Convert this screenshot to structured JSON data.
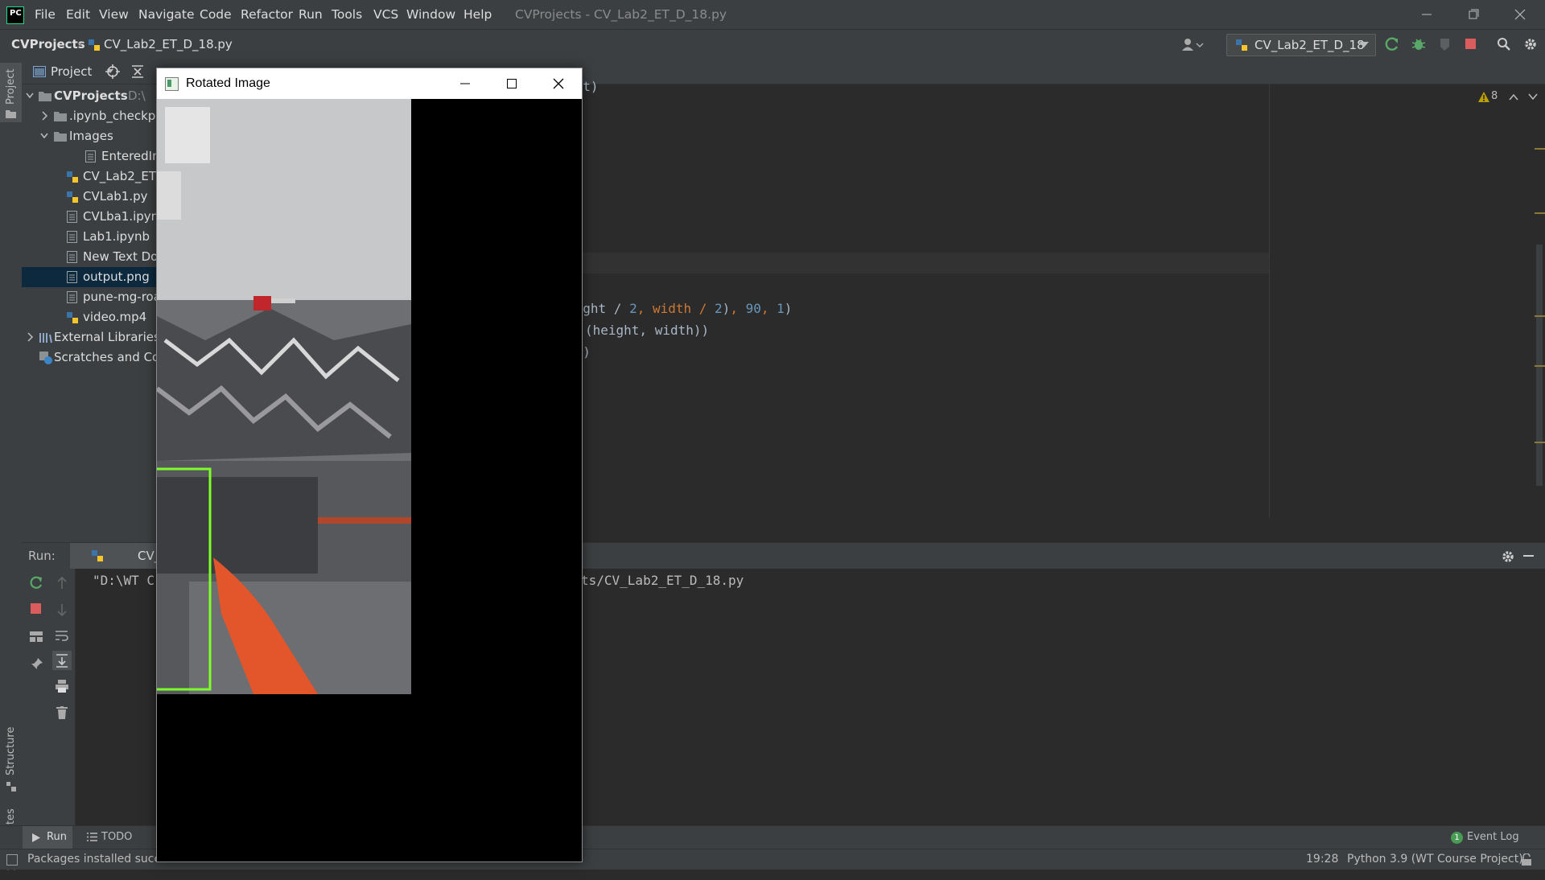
{
  "app": {
    "title": "CVProjects - CV_Lab2_ET_D_18.py",
    "menu": [
      "File",
      "Edit",
      "View",
      "Navigate",
      "Code",
      "Refactor",
      "Run",
      "Tools",
      "VCS",
      "Window",
      "Help"
    ]
  },
  "navbar": {
    "project": "CVProjects",
    "file": "CV_Lab2_ET_D_18.py",
    "run_config": "CV_Lab2_ET_D_18"
  },
  "left_strip": {
    "project_label": "Project",
    "structure_label": "Structure",
    "favorites_label": "Favorites"
  },
  "project_panel": {
    "view_label": "Project",
    "tree": [
      {
        "name": "CVProjects",
        "extra": "D:\\",
        "type": "folder",
        "expanded": true
      },
      {
        "name": ".ipynb_checkpoints",
        "type": "folder",
        "expanded": false
      },
      {
        "name": "Images",
        "type": "folder",
        "expanded": true
      },
      {
        "name": "EnteredImage",
        "type": "file"
      },
      {
        "name": "CV_Lab2_ET_D_18.py",
        "type": "python"
      },
      {
        "name": "CVLab1.py",
        "type": "python"
      },
      {
        "name": "CVLba1.ipynb",
        "type": "file"
      },
      {
        "name": "Lab1.ipynb",
        "type": "file"
      },
      {
        "name": "New Text Document",
        "type": "file"
      },
      {
        "name": "output.png",
        "type": "file",
        "selected": true
      },
      {
        "name": "pune-mg-road",
        "type": "file"
      },
      {
        "name": "video.mp4",
        "type": "python"
      },
      {
        "name": "External Libraries",
        "type": "library"
      },
      {
        "name": "Scratches and Consoles",
        "type": "scratch"
      }
    ]
  },
  "editor": {
    "warnings": "8",
    "code": {
      "line_top": "dst)",
      "l1_a": "eight / ",
      "l1_b": "2",
      "l1_c": ", width / ",
      "l1_d": "2",
      "l1_e": ")",
      "l1_f": ", ",
      "l1_g": "90",
      "l1_h": ", ",
      "l1_i": "1",
      "l1_j": ")",
      "l2": "(height, width))",
      "l3": "st)"
    }
  },
  "run_panel": {
    "label": "Run:",
    "tab": "CV_Lab2_ET_D_18",
    "console_start": "\"D:\\WT C",
    "console_end": "ts/CV_Lab2_ET_D_18.py"
  },
  "bottom_tools": {
    "run": "Run",
    "todo": "TODO",
    "event_log": "Event Log",
    "event_count": "1"
  },
  "status": {
    "message": "Packages installed succe",
    "position": "19:28",
    "interpreter": "Python 3.9 (WT Course Project)"
  },
  "image_window": {
    "title": "Rotated Image"
  },
  "colors": {
    "ide_bg": "#2b2b2b",
    "panel_bg": "#3c3f41",
    "selection": "#0d293e",
    "bbox": "#7cff2a"
  }
}
